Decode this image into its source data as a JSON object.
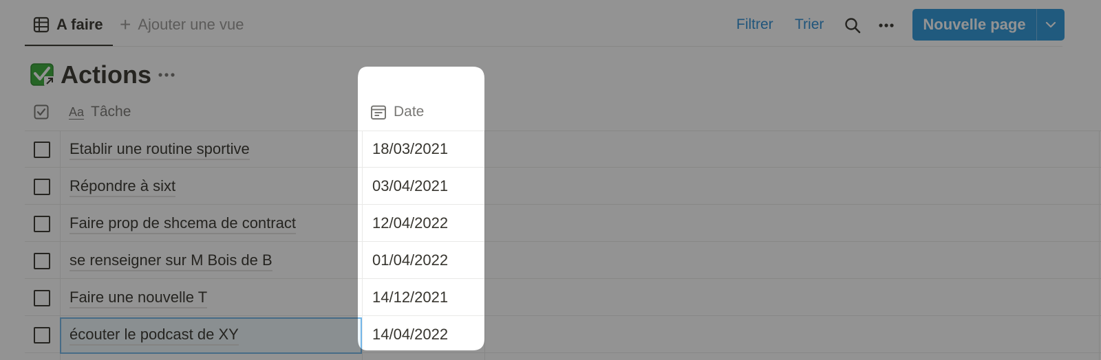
{
  "toolbar": {
    "tab_label": "A faire",
    "add_view_label": "Ajouter une vue",
    "filter_label": "Filtrer",
    "sort_label": "Trier",
    "new_page_label": "Nouvelle page"
  },
  "database": {
    "title": "Actions"
  },
  "table": {
    "columns": {
      "task": "Tâche",
      "task_type_glyph": "Aa",
      "date": "Date"
    },
    "rows": [
      {
        "task": "Etablir une routine sportive",
        "date": "18/03/2021"
      },
      {
        "task": "Répondre à sixt",
        "date": "03/04/2021"
      },
      {
        "task": "Faire prop de shcema de contract",
        "date": "12/04/2022"
      },
      {
        "task": "se renseigner sur M Bois de B",
        "date": "01/04/2022"
      },
      {
        "task": "Faire une nouvelle T",
        "date": "14/12/2021"
      },
      {
        "task": "écouter le podcast de XY",
        "date": "14/04/2022"
      }
    ]
  },
  "colors": {
    "accent": "#2f97d9",
    "link": "#2f8fd4",
    "text": "#37352f",
    "muted": "#787774",
    "overlay": "rgba(15,15,15,0.45)"
  },
  "icons": {
    "tab": "table-icon",
    "add": "plus-icon",
    "search": "search-icon",
    "more": "more-horizontal-icon",
    "new_page_arrow": "chevron-down-icon",
    "database": "checkbox-link-icon",
    "title_more": "more-horizontal-icon",
    "check_column": "checkbox-column-icon",
    "task_column": "text-property-icon",
    "date_column": "calendar-icon"
  }
}
